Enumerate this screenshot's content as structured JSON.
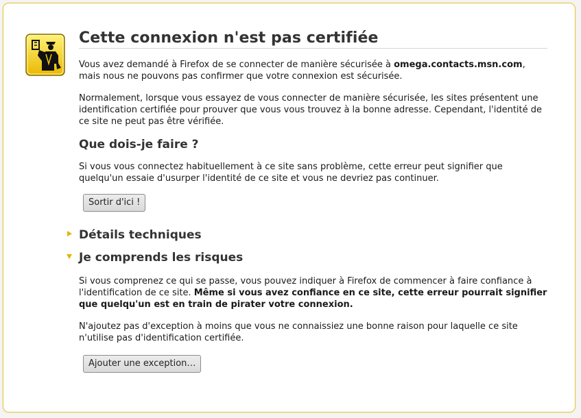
{
  "title": "Cette connexion n'est pas certifiée",
  "intro": {
    "before": "Vous avez demandé à Firefox de se connecter de manière sécurisée à ",
    "host": "omega.contacts.msn.com",
    "after": ", mais nous ne pouvons pas confirmer que votre connexion est sécurisée."
  },
  "normal_text": "Normalement, lorsque vous essayez de vous connecter de manière sécurisée, les sites présentent une identification certifiée pour prouver que vous vous trouvez à la bonne adresse. Cependant, l'identité de ce site ne peut pas être vérifiée.",
  "what_heading": "Que dois-je faire ?",
  "what_text": "Si vous vous connectez habituellement à ce site sans problème, cette erreur peut signifier que quelqu'un essaie d'usurper l'identité de ce site et vous ne devriez pas continuer.",
  "leave_button": "Sortir d'ici !",
  "technical_heading": "Détails techniques",
  "risks_heading": "Je comprends les risques",
  "risks_text": {
    "before": "Si vous comprenez ce qui se passe, vous pouvez indiquer à Firefox de commencer à faire confiance à l'identification de ce site. ",
    "bold": "Même si vous avez confiance en ce site, cette erreur pourrait signifier que quelqu'un est en train de pirater votre connexion."
  },
  "exception_text": "N'ajoutez pas d'exception à moins que vous ne connaissiez une bonne raison pour laquelle ce site n'utilise pas d'identification certifiée.",
  "add_exception_button": "Ajouter une exception…",
  "colors": {
    "accent": "#e4b400",
    "icon_bg": "#f5d100",
    "border": "#e3c65a"
  },
  "icons": {
    "header": "security-officer-icon",
    "technical_toggle": "triangle-right-icon",
    "risks_toggle": "triangle-down-icon"
  }
}
